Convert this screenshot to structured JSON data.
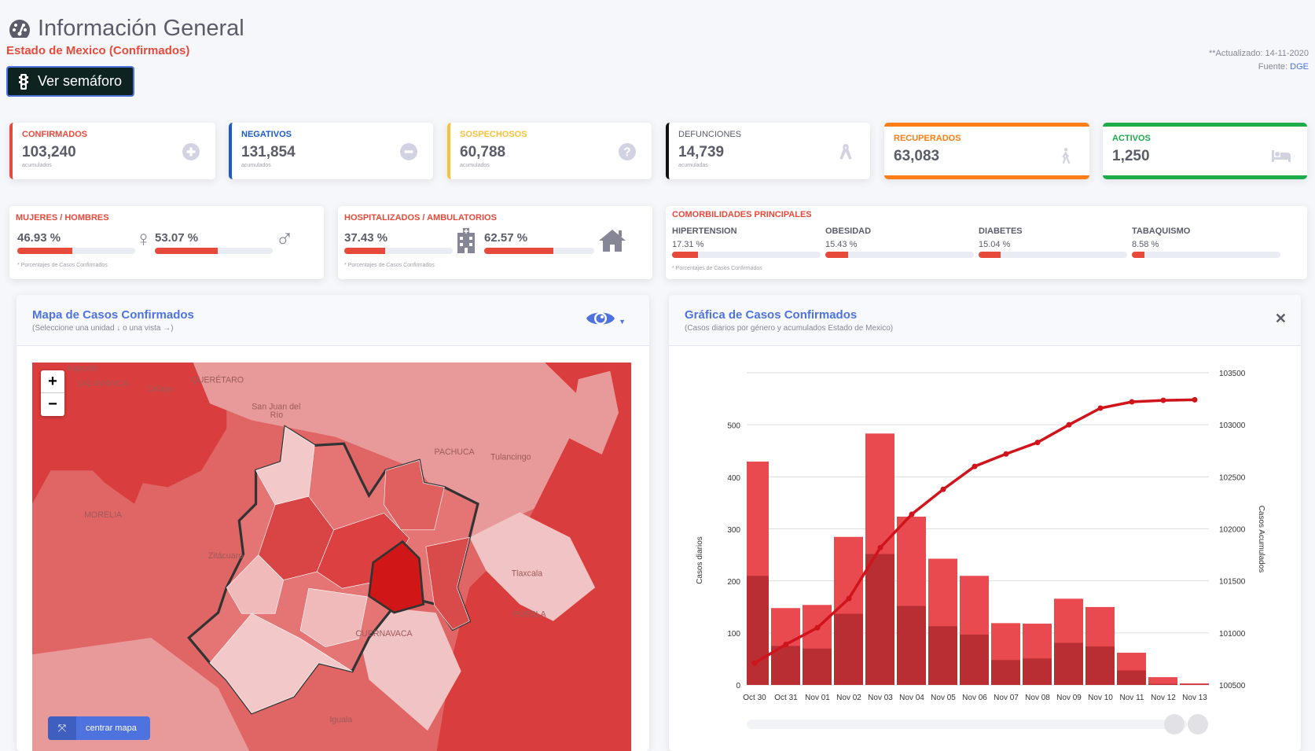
{
  "header": {
    "title": "Información General",
    "subtitle": "Estado de Mexico (Confirmados)",
    "semaforo_button": "Ver semáforo",
    "updated": "**Actualizado: 14-11-2020",
    "source_label": "Fuente:",
    "source_link": "DGE"
  },
  "stats": [
    {
      "label": "CONFIRMADOS",
      "value": "103,240",
      "sub": "acumulados",
      "color": "#e74a3b",
      "icon": "plus-circle-icon"
    },
    {
      "label": "NEGATIVOS",
      "value": "131,854",
      "sub": "acumulados",
      "color": "#1c5bc4",
      "icon": "minus-circle-icon"
    },
    {
      "label": "SOSPECHOSOS",
      "value": "60,788",
      "sub": "acumulados",
      "color": "#f6c23e",
      "icon": "question-circle-icon"
    },
    {
      "label": "DEFUNCIONES",
      "value": "14,739",
      "sub": "acumuladas",
      "color": "#111111",
      "icon": "ribbon-icon"
    },
    {
      "label": "RECUPERADOS",
      "value": "63,083",
      "color": "#fd7e14",
      "icon": "walking-icon"
    },
    {
      "label": "ACTIVOS",
      "value": "1,250",
      "color": "#1cac4a",
      "icon": "bed-icon"
    }
  ],
  "gender": {
    "label": "MUJERES / HOMBRES",
    "women": "46.93 %",
    "women_pct": 46.93,
    "men": "53.07 %",
    "men_pct": 53.07,
    "note": "* Porcentajes  de Casos Confirmados"
  },
  "hospital": {
    "label": "HOSPITALIZADOS / AMBULATORIOS",
    "hosp": "37.43 %",
    "hosp_pct": 37.43,
    "amb": "62.57 %",
    "amb_pct": 62.57,
    "note": "* Porcentajes  de Casos Confirmados"
  },
  "comorbidities": {
    "label": "COMORBILIDADES PRINCIPALES",
    "items": [
      {
        "name": "HIPERTENSION",
        "value": "17.31 %",
        "pct": 17.31
      },
      {
        "name": "OBESIDAD",
        "value": "15.43 %",
        "pct": 15.43
      },
      {
        "name": "DIABETES",
        "value": "15.04 %",
        "pct": 15.04
      },
      {
        "name": "TABAQUISMO",
        "value": "8.58 %",
        "pct": 8.58
      }
    ],
    "note": "* Porcentajes  de Casos Confirmados"
  },
  "map": {
    "title": "Mapa de Casos Confirmados",
    "subtitle": "(Seleccione una unidad ↓ o una vista →)",
    "zoom_in": "+",
    "zoom_out": "−",
    "center_button": "centrar mapa",
    "labels": {
      "irapuato": "Irapuato",
      "salamanca": "SALAMANCA",
      "celaya": "Celaya",
      "queretaro": "QUERÉTARO",
      "sanjuan1": "San Juan del",
      "sanjuan2": "Río",
      "pachuca": "PACHUCA",
      "tulancingo": "Tulancingo",
      "morelia": "MORELIA",
      "zitacuaro": "Zitácuaro",
      "tlaxcala": "Tlaxcala",
      "puebla": "PUEBLA",
      "cuernavaca": "CUERNAVACA",
      "iguala": "Iguala"
    }
  },
  "chart_panel": {
    "title": "Gráfica de Casos Confirmados",
    "subtitle": "(Casos diarios por género y acumulados Estado de Mexico)"
  },
  "chart_data": {
    "type": "bar+line",
    "categories": [
      "Oct 30",
      "Oct 31",
      "Nov 01",
      "Nov 02",
      "Nov 03",
      "Nov 04",
      "Nov 05",
      "Nov 06",
      "Nov 07",
      "Nov 08",
      "Nov 09",
      "Nov 10",
      "Nov 11",
      "Nov 12",
      "Nov 13"
    ],
    "series": [
      {
        "type": "bar",
        "color": "#e84a4f",
        "values": [
          430,
          148,
          154,
          285,
          484,
          324,
          243,
          210,
          119,
          118,
          166,
          150,
          62,
          15,
          3
        ]
      },
      {
        "type": "bar",
        "color": "#b82e32",
        "values": [
          210,
          75,
          70,
          137,
          252,
          152,
          113,
          97,
          48,
          51,
          81,
          74,
          28,
          2,
          1
        ]
      },
      {
        "type": "line",
        "axis": "right",
        "color": "#d0141b",
        "values": [
          100710,
          100890,
          101050,
          101330,
          101820,
          102140,
          102380,
          102600,
          102720,
          102830,
          103000,
          103160,
          103220,
          103235,
          103240
        ]
      }
    ],
    "ylabel": "Casos diarios",
    "ylabel_right": "Casos Acumulados",
    "yticks": [
      0,
      100,
      200,
      300,
      400,
      500
    ],
    "yticks_right": [
      100500,
      101000,
      101500,
      102000,
      102500,
      103000,
      103500
    ],
    "ylim": [
      0,
      601
    ],
    "ylim_right": [
      100500,
      103500
    ],
    "grid": true
  }
}
